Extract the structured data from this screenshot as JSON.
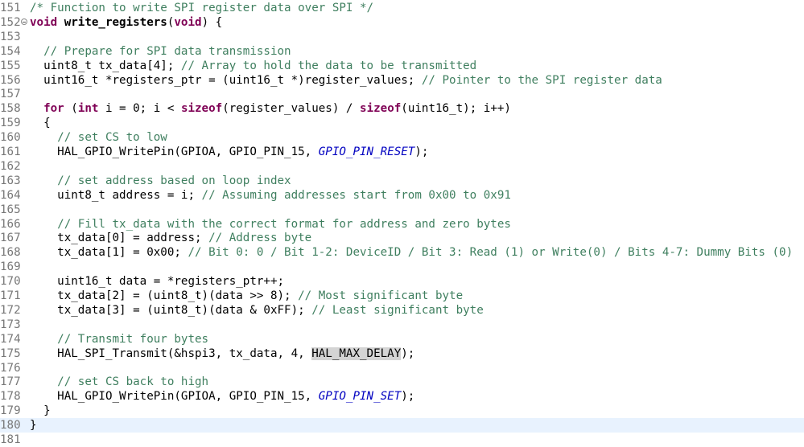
{
  "lines": [
    {
      "num": "151",
      "segs": [
        {
          "t": "/* Function to write SPI register data over SPI */",
          "c": "cm"
        }
      ]
    },
    {
      "num": "152",
      "fold": true,
      "segs": [
        {
          "t": "void",
          "c": "kw"
        },
        {
          "t": " "
        },
        {
          "t": "write_registers",
          "c": "bold"
        },
        {
          "t": "("
        },
        {
          "t": "void",
          "c": "kw"
        },
        {
          "t": ") {"
        }
      ]
    },
    {
      "num": "153",
      "segs": []
    },
    {
      "num": "154",
      "segs": [
        {
          "t": "  "
        },
        {
          "t": "// Prepare for SPI data transmission",
          "c": "cm"
        }
      ]
    },
    {
      "num": "155",
      "segs": [
        {
          "t": "  uint8_t tx_data[4]; "
        },
        {
          "t": "// Array to hold the data to be transmitted",
          "c": "cm"
        }
      ]
    },
    {
      "num": "156",
      "segs": [
        {
          "t": "  uint16_t *registers_ptr = (uint16_t *)register_values; "
        },
        {
          "t": "// Pointer to the SPI register data",
          "c": "cm"
        }
      ]
    },
    {
      "num": "157",
      "segs": []
    },
    {
      "num": "158",
      "segs": [
        {
          "t": "  "
        },
        {
          "t": "for",
          "c": "kw"
        },
        {
          "t": " ("
        },
        {
          "t": "int",
          "c": "kw"
        },
        {
          "t": " i = 0; i < "
        },
        {
          "t": "sizeof",
          "c": "kw"
        },
        {
          "t": "(register_values) / "
        },
        {
          "t": "sizeof",
          "c": "kw"
        },
        {
          "t": "(uint16_t); i++)"
        }
      ]
    },
    {
      "num": "159",
      "segs": [
        {
          "t": "  {"
        }
      ]
    },
    {
      "num": "160",
      "segs": [
        {
          "t": "    "
        },
        {
          "t": "// set CS to low",
          "c": "cm"
        }
      ]
    },
    {
      "num": "161",
      "segs": [
        {
          "t": "    HAL_GPIO_WritePin(GPIOA, GPIO_PIN_15, "
        },
        {
          "t": "GPIO_PIN_RESET",
          "c": "mac"
        },
        {
          "t": ");"
        }
      ]
    },
    {
      "num": "162",
      "segs": []
    },
    {
      "num": "163",
      "segs": [
        {
          "t": "    "
        },
        {
          "t": "// set address based on loop index",
          "c": "cm"
        }
      ]
    },
    {
      "num": "164",
      "segs": [
        {
          "t": "    uint8_t address = i; "
        },
        {
          "t": "// Assuming addresses start from 0x00 to 0x91",
          "c": "cm"
        }
      ]
    },
    {
      "num": "165",
      "segs": []
    },
    {
      "num": "166",
      "segs": [
        {
          "t": "    "
        },
        {
          "t": "// Fill tx_data with the correct format for address and zero bytes",
          "c": "cm"
        }
      ]
    },
    {
      "num": "167",
      "segs": [
        {
          "t": "    tx_data[0] = address; "
        },
        {
          "t": "// Address byte",
          "c": "cm"
        }
      ]
    },
    {
      "num": "168",
      "segs": [
        {
          "t": "    tx_data[1] = 0x00; "
        },
        {
          "t": "// Bit 0: 0 / Bit 1-2: DeviceID / Bit 3: Read (1) or Write(0) / Bits 4-7: Dummy Bits (0)",
          "c": "cm"
        }
      ]
    },
    {
      "num": "169",
      "segs": []
    },
    {
      "num": "170",
      "segs": [
        {
          "t": "    uint16_t data = *registers_ptr++;"
        }
      ]
    },
    {
      "num": "171",
      "segs": [
        {
          "t": "    tx_data[2] = (uint8_t)(data >> 8); "
        },
        {
          "t": "// Most significant byte",
          "c": "cm"
        }
      ]
    },
    {
      "num": "172",
      "segs": [
        {
          "t": "    tx_data[3] = (uint8_t)(data & 0xFF); "
        },
        {
          "t": "// Least significant byte",
          "c": "cm"
        }
      ]
    },
    {
      "num": "173",
      "segs": []
    },
    {
      "num": "174",
      "segs": [
        {
          "t": "    "
        },
        {
          "t": "// Transmit four bytes",
          "c": "cm"
        }
      ]
    },
    {
      "num": "175",
      "segs": [
        {
          "t": "    HAL_SPI_Transmit(&hspi3, tx_data, 4, "
        },
        {
          "t": "HAL_MAX_DELAY",
          "c": "hl"
        },
        {
          "t": ");"
        }
      ]
    },
    {
      "num": "176",
      "segs": []
    },
    {
      "num": "177",
      "segs": [
        {
          "t": "    "
        },
        {
          "t": "// set CS back to high",
          "c": "cm"
        }
      ]
    },
    {
      "num": "178",
      "segs": [
        {
          "t": "    HAL_GPIO_WritePin(GPIOA, GPIO_PIN_15, "
        },
        {
          "t": "GPIO_PIN_SET",
          "c": "mac"
        },
        {
          "t": ");"
        }
      ]
    },
    {
      "num": "179",
      "segs": [
        {
          "t": "  }"
        }
      ]
    },
    {
      "num": "180",
      "current": true,
      "segs": [
        {
          "t": "}"
        }
      ]
    },
    {
      "num": "181",
      "segs": []
    }
  ]
}
